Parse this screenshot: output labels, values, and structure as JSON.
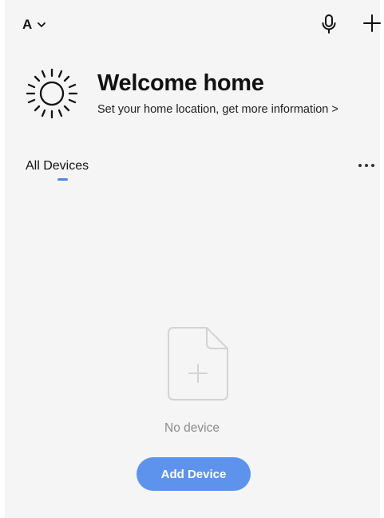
{
  "header": {
    "home_initial": "A",
    "icons": {
      "home_dropdown": "chevron-down-icon",
      "voice": "microphone-icon",
      "add": "plus-icon"
    }
  },
  "welcome": {
    "icon": "sun-icon",
    "title": "Welcome home",
    "subtitle": "Set your home location, get more information >"
  },
  "devices": {
    "tabs": [
      {
        "label": "All Devices",
        "active": true
      }
    ],
    "more_icon": "more-horizontal-icon",
    "empty_state": {
      "icon": "add-file-icon",
      "message": "No device",
      "button_label": "Add Device"
    }
  },
  "colors": {
    "background": "#f5f5f6",
    "accent": "#5d93ec",
    "tab_indicator": "#4f86e8",
    "muted_text": "#8a8a8a"
  }
}
